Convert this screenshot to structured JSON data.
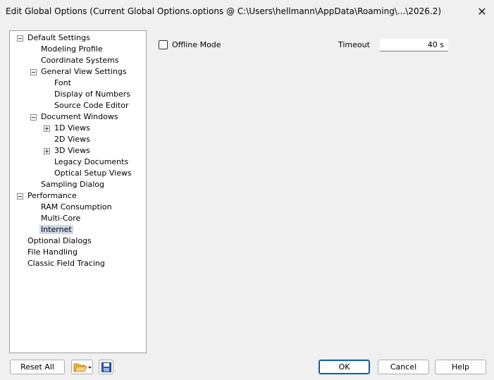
{
  "window": {
    "title": "Edit Global Options (Current Global Options.options @ C:\\Users\\hellmann\\AppData\\Roaming\\...\\2026.2)",
    "close_glyph": "✕"
  },
  "tree": [
    {
      "label": "Default Settings",
      "level": 0,
      "toggle": "minus"
    },
    {
      "label": "Modeling Profile",
      "level": 1,
      "toggle": null
    },
    {
      "label": "Coordinate Systems",
      "level": 1,
      "toggle": null
    },
    {
      "label": "General View Settings",
      "level": 1,
      "toggle": "minus"
    },
    {
      "label": "Font",
      "level": 2,
      "toggle": null
    },
    {
      "label": "Display of Numbers",
      "level": 2,
      "toggle": null
    },
    {
      "label": "Source Code Editor",
      "level": 2,
      "toggle": null
    },
    {
      "label": "Document Windows",
      "level": 1,
      "toggle": "minus"
    },
    {
      "label": "1D Views",
      "level": 2,
      "toggle": "plus"
    },
    {
      "label": "2D Views",
      "level": 2,
      "toggle": null
    },
    {
      "label": "3D Views",
      "level": 2,
      "toggle": "plus"
    },
    {
      "label": "Legacy Documents",
      "level": 2,
      "toggle": null
    },
    {
      "label": "Optical Setup Views",
      "level": 2,
      "toggle": null
    },
    {
      "label": "Sampling Dialog",
      "level": 1,
      "toggle": null
    },
    {
      "label": "Performance",
      "level": 0,
      "toggle": "minus"
    },
    {
      "label": "RAM Consumption",
      "level": 1,
      "toggle": null
    },
    {
      "label": "Multi-Core",
      "level": 1,
      "toggle": null
    },
    {
      "label": "Internet",
      "level": 1,
      "toggle": null,
      "selected": true
    },
    {
      "label": "Optional Dialogs",
      "level": 0,
      "toggle": null
    },
    {
      "label": "File Handling",
      "level": 0,
      "toggle": null
    },
    {
      "label": "Classic Field Tracing",
      "level": 0,
      "toggle": null
    }
  ],
  "panel": {
    "offline_mode_label": "Offline Mode",
    "offline_mode_checked": false,
    "timeout_label": "Timeout",
    "timeout_value": "40 s"
  },
  "footer": {
    "reset_all": "Reset All",
    "ok": "OK",
    "cancel": "Cancel",
    "help": "Help"
  },
  "icons": {
    "open": "folder-open-icon",
    "save": "save-disk-icon"
  }
}
